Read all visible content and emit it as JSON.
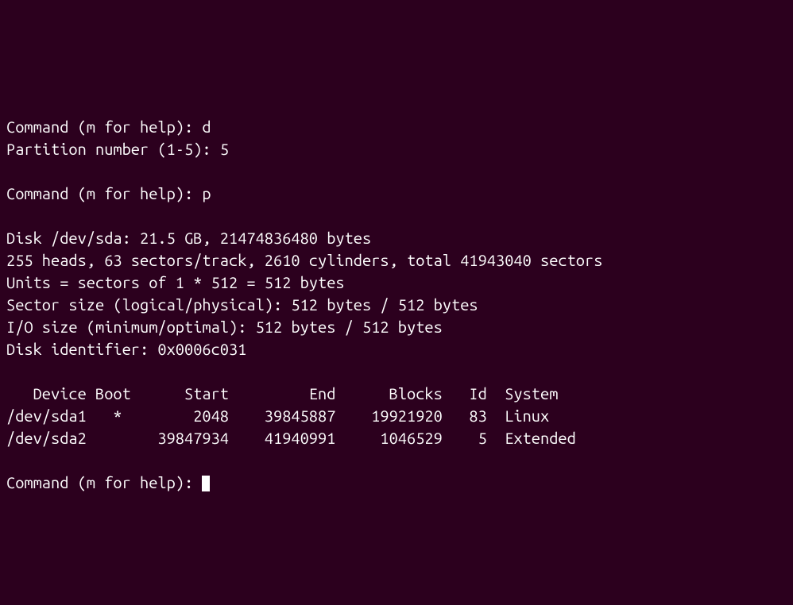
{
  "prompts": {
    "command1_prompt": "Command (m for help): ",
    "command1_input": "d",
    "partition_prompt": "Partition number (1-5): ",
    "partition_input": "5",
    "command2_prompt": "Command (m for help): ",
    "command2_input": "p",
    "command3_prompt": "Command (m for help): "
  },
  "disk_info": {
    "line1": "Disk /dev/sda: 21.5 GB, 21474836480 bytes",
    "line2": "255 heads, 63 sectors/track, 2610 cylinders, total 41943040 sectors",
    "line3": "Units = sectors of 1 * 512 = 512 bytes",
    "line4": "Sector size (logical/physical): 512 bytes / 512 bytes",
    "line5": "I/O size (minimum/optimal): 512 bytes / 512 bytes",
    "line6": "Disk identifier: 0x0006c031"
  },
  "table": {
    "header": "   Device Boot      Start         End      Blocks   Id  System",
    "row1": "/dev/sda1   *        2048    39845887    19921920   83  Linux",
    "row2": "/dev/sda2        39847934    41940991     1046529    5  Extended"
  }
}
